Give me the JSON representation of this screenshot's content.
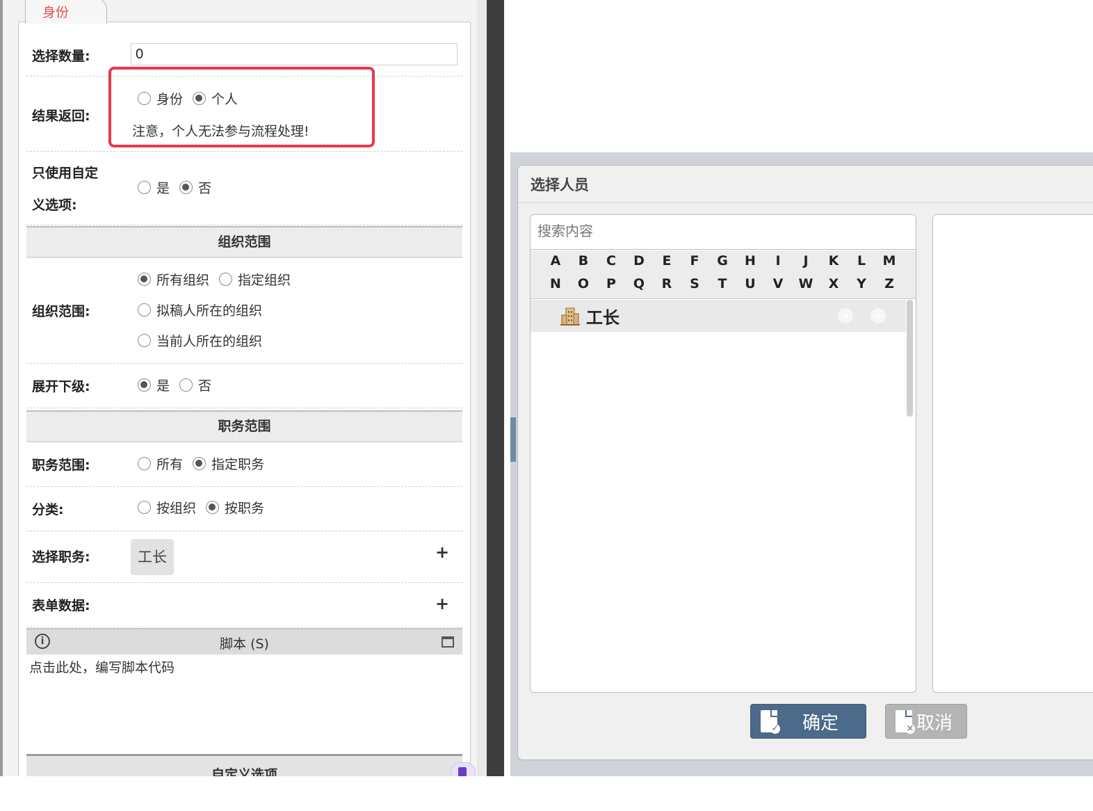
{
  "left_panel": {
    "tab_label": "身份",
    "fields": {
      "select_count": {
        "label": "选择数量:",
        "value": "0"
      },
      "result_return": {
        "label": "结果返回:",
        "options": [
          "身份",
          "个人"
        ],
        "selected": "个人",
        "note": "注意，个人无法参与流程处理!"
      },
      "custom_only": {
        "label_line1": "只使用自定",
        "label_line2": "义选项:",
        "options": [
          "是",
          "否"
        ],
        "selected": "否"
      }
    },
    "org_section": {
      "title": "组织范围",
      "org_scope": {
        "label": "组织范围:",
        "options": [
          "所有组织",
          "指定组织",
          "拟稿人所在的组织",
          "当前人所在的组织"
        ],
        "selected": "所有组织"
      },
      "expand_sub": {
        "label": "展开下级:",
        "options": [
          "是",
          "否"
        ],
        "selected": "是"
      }
    },
    "duty_section": {
      "title": "职务范围",
      "duty_scope": {
        "label": "职务范围:",
        "options": [
          "所有",
          "指定职务"
        ],
        "selected": "指定职务"
      },
      "category": {
        "label": "分类:",
        "options": [
          "按组织",
          "按职务"
        ],
        "selected": "按职务"
      },
      "select_duty": {
        "label": "选择职务:",
        "chip": "工长",
        "add": "+"
      },
      "form_data": {
        "label": "表单数据:",
        "add": "+"
      }
    },
    "script": {
      "info_icon": "info-icon",
      "title": "脚本 (S)",
      "placeholder": "点击此处，编写脚本代码"
    },
    "custom_options_title": "自定义选项"
  },
  "dialog": {
    "title": "选择人员",
    "search_placeholder": "搜索内容",
    "alphabet_row1": [
      "A",
      "B",
      "C",
      "D",
      "E",
      "F",
      "G",
      "H",
      "I",
      "J",
      "K",
      "L",
      "M"
    ],
    "alphabet_row2": [
      "N",
      "O",
      "P",
      "Q",
      "R",
      "S",
      "T",
      "U",
      "V",
      "W",
      "X",
      "Y",
      "Z"
    ],
    "list": [
      {
        "icon": "building-icon",
        "label": "工长"
      }
    ],
    "buttons": {
      "ok": "确定",
      "cancel": "取消"
    }
  },
  "colors": {
    "highlight": "#e8384f",
    "ok_button": "#4c6a8a",
    "cancel_button": "#b4b4b4",
    "tab_text": "#e05050"
  }
}
